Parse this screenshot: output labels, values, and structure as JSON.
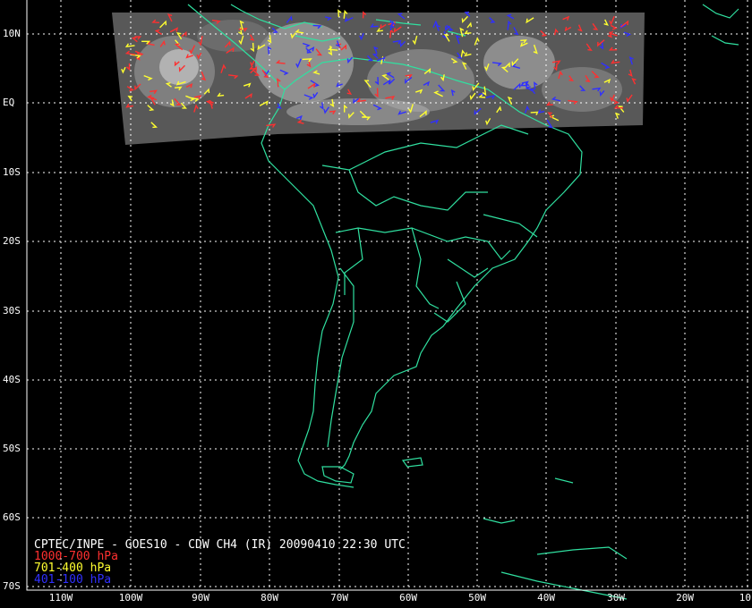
{
  "title": "CPTEC/INPE - GOES10 - CDW CH4 (IR) 20090410 22:30 UTC",
  "legend": [
    {
      "label": "1000-700 hPa",
      "color": "#ff3030"
    },
    {
      "label": "701-400 hPa",
      "color": "#ffff30"
    },
    {
      "label": "401-100 hPa",
      "color": "#3030ff"
    }
  ],
  "lat_labels": [
    "10N",
    "EQ",
    "10S",
    "20S",
    "30S",
    "40S",
    "50S",
    "60S",
    "70S"
  ],
  "lon_labels": [
    "110W",
    "100W",
    "90W",
    "80W",
    "70W",
    "60W",
    "50W",
    "40W",
    "30W",
    "20W",
    "10"
  ],
  "colors": {
    "background": "#000000",
    "coastline": "#30e0a0",
    "grid": "#ffffff",
    "text": "#ffffff"
  }
}
